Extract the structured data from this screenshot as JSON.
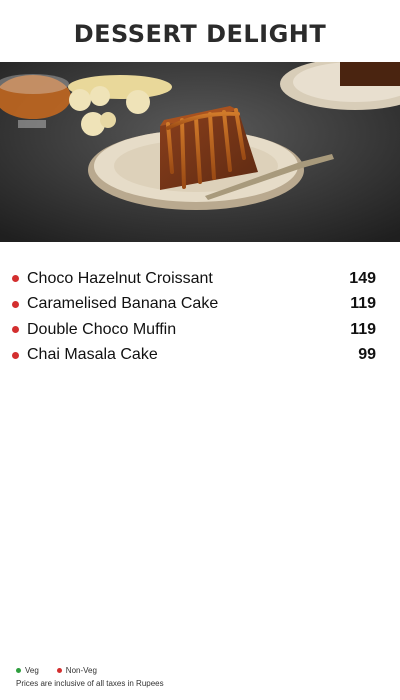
{
  "title": "DESSERT DELIGHT",
  "colors": {
    "non_veg": "#d32f2f",
    "veg": "#2e9e3e"
  },
  "items": [
    {
      "name": "Choco Hazelnut Croissant",
      "price": "149",
      "type": "non-veg"
    },
    {
      "name": "Caramelised Banana Cake",
      "price": "119",
      "type": "non-veg"
    },
    {
      "name": "Double Choco Muffin",
      "price": "119",
      "type": "non-veg"
    },
    {
      "name": "Chai Masala Cake",
      "price": "99",
      "type": "non-veg"
    }
  ],
  "legend": {
    "veg": "Veg",
    "non_veg": "Non-Veg"
  },
  "note": "Prices are inclusive of all taxes in Rupees"
}
